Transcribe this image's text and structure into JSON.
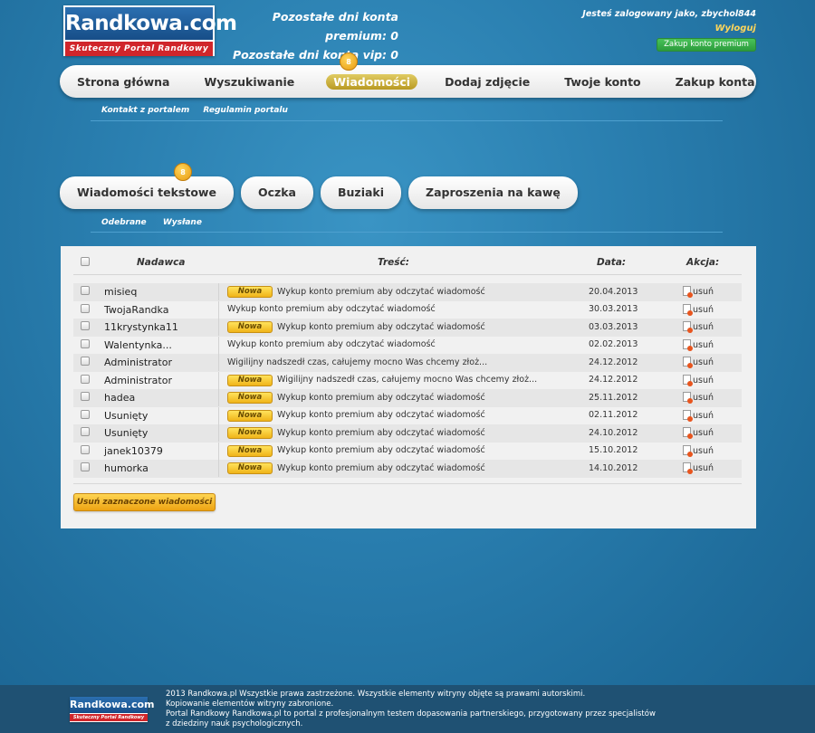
{
  "header": {
    "logo": {
      "title": "Randkowa.com",
      "tagline": "Skuteczny Portal Randkowy"
    },
    "premium_days": "Pozostałe dni konta premium: 0",
    "vip_days": "Pozostałe dni konta vip: 0",
    "logged_in_text": "Jesteś zalogowany jako, zbychol844",
    "logout_label": "Wyloguj",
    "buy_premium_label": "Zakup konto premium"
  },
  "main_nav": {
    "items": [
      "Strona główna",
      "Wyszukiwanie",
      "Wiadomości",
      "Dodaj zdjęcie",
      "Twoje konto",
      "Zakup konta"
    ],
    "active_index": 2,
    "messages_badge": "8"
  },
  "sub_nav": {
    "items": [
      "Kontakt z portalem",
      "Regulamin portalu"
    ]
  },
  "tabs": {
    "items": [
      "Wiadomości tekstowe",
      "Oczka",
      "Buziaki",
      "Zaproszenia na kawę"
    ],
    "badge": "8",
    "sub_items": [
      "Odebrane",
      "Wysłane"
    ]
  },
  "table": {
    "headers": {
      "sender": "Nadawca",
      "content": "Treść:",
      "date": "Data:",
      "action": "Akcja:"
    },
    "new_label": "Nowa",
    "delete_label": "usuń",
    "rows": [
      {
        "sender": "misieq",
        "is_new": true,
        "content": "Wykup konto premium aby odczytać wiadomość",
        "date": "20.04.2013"
      },
      {
        "sender": "TwojaRandka",
        "is_new": false,
        "content": "Wykup konto premium aby odczytać wiadomość",
        "date": "30.03.2013"
      },
      {
        "sender": "11krystynka11",
        "is_new": true,
        "content": "Wykup konto premium aby odczytać wiadomość",
        "date": "03.03.2013"
      },
      {
        "sender": "Walentynka...",
        "is_new": false,
        "content": "Wykup konto premium aby odczytać wiadomość",
        "date": "02.02.2013"
      },
      {
        "sender": "Administrator",
        "is_new": false,
        "content": "Wigilijny nadszedł czas, całujemy mocno Was chcemy złoż...",
        "date": "24.12.2012"
      },
      {
        "sender": "Administrator",
        "is_new": true,
        "content": "Wigilijny nadszedł czas, całujemy mocno Was chcemy złoż...",
        "date": "24.12.2012"
      },
      {
        "sender": "hadea",
        "is_new": true,
        "content": "Wykup konto premium aby odczytać wiadomość",
        "date": "25.11.2012"
      },
      {
        "sender": "Usunięty",
        "is_new": true,
        "content": "Wykup konto premium aby odczytać wiadomość",
        "date": "02.11.2012"
      },
      {
        "sender": "Usunięty",
        "is_new": true,
        "content": "Wykup konto premium aby odczytać wiadomość",
        "date": "24.10.2012"
      },
      {
        "sender": "janek10379",
        "is_new": true,
        "content": "Wykup konto premium aby odczytać wiadomość",
        "date": "15.10.2012"
      },
      {
        "sender": "humorka",
        "is_new": true,
        "content": "Wykup konto premium aby odczytać wiadomość",
        "date": "14.10.2012"
      }
    ],
    "delete_selected_label": "Usuń zaznaczone wiadomości"
  },
  "footer": {
    "logo": {
      "title": "Randkowa.com",
      "tagline": "Skuteczny Portal Randkowy"
    },
    "lines": [
      "2013 Randkowa.pl Wszystkie prawa zastrzeżone. Wszystkie elementy witryny objęte są prawami autorskimi.",
      "Kopiowanie elementów witryny zabronione.",
      "Portal Randkowy Randkowa.pl to portal z profesjonalnym testem dopasowania partnerskiego, przygotowany przez specjalistów",
      "z dziedziny nauk psychologicznych."
    ]
  }
}
